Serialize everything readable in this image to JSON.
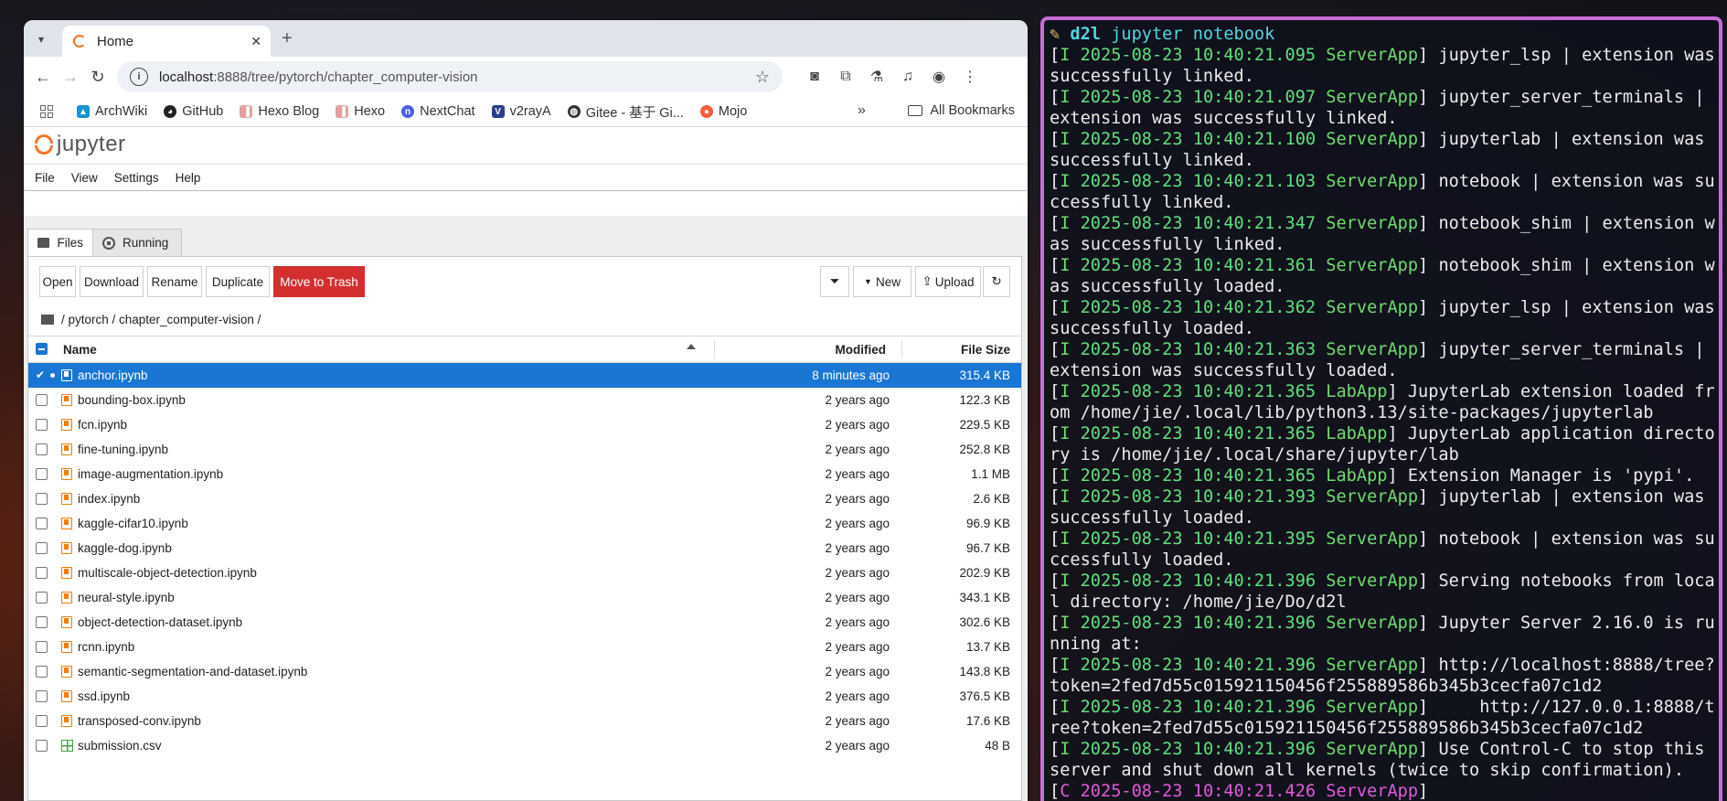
{
  "browser": {
    "tab_title": "Home",
    "url_host": "localhost",
    "url_rest": ":8888/tree/pytorch/chapter_computer-vision",
    "bookmarks": [
      "ArchWiki",
      "GitHub",
      "Hexo Blog",
      "Hexo",
      "NextChat",
      "v2rayA",
      "Gitee - 基于 Gi...",
      "Mojo"
    ],
    "all_bookmarks": "All Bookmarks"
  },
  "jupyter": {
    "logo_text": "jupyter",
    "menu": [
      "File",
      "View",
      "Settings",
      "Help"
    ],
    "tabs": [
      "Files",
      "Running"
    ],
    "actions": {
      "open": "Open",
      "download": "Download",
      "rename": "Rename",
      "duplicate": "Duplicate",
      "trash": "Move to Trash",
      "new": "New",
      "upload": "Upload"
    },
    "breadcrumb": "/ pytorch / chapter_computer-vision /",
    "columns": {
      "name": "Name",
      "modified": "Modified",
      "size": "File Size"
    },
    "files": [
      {
        "name": "anchor.ipynb",
        "modified": "8 minutes ago",
        "size": "315.4 KB",
        "type": "notebook",
        "selected": true
      },
      {
        "name": "bounding-box.ipynb",
        "modified": "2 years ago",
        "size": "122.3 KB",
        "type": "notebook"
      },
      {
        "name": "fcn.ipynb",
        "modified": "2 years ago",
        "size": "229.5 KB",
        "type": "notebook"
      },
      {
        "name": "fine-tuning.ipynb",
        "modified": "2 years ago",
        "size": "252.8 KB",
        "type": "notebook"
      },
      {
        "name": "image-augmentation.ipynb",
        "modified": "2 years ago",
        "size": "1.1 MB",
        "type": "notebook"
      },
      {
        "name": "index.ipynb",
        "modified": "2 years ago",
        "size": "2.6 KB",
        "type": "notebook"
      },
      {
        "name": "kaggle-cifar10.ipynb",
        "modified": "2 years ago",
        "size": "96.9 KB",
        "type": "notebook"
      },
      {
        "name": "kaggle-dog.ipynb",
        "modified": "2 years ago",
        "size": "96.7 KB",
        "type": "notebook"
      },
      {
        "name": "multiscale-object-detection.ipynb",
        "modified": "2 years ago",
        "size": "202.9 KB",
        "type": "notebook"
      },
      {
        "name": "neural-style.ipynb",
        "modified": "2 years ago",
        "size": "343.1 KB",
        "type": "notebook"
      },
      {
        "name": "object-detection-dataset.ipynb",
        "modified": "2 years ago",
        "size": "302.6 KB",
        "type": "notebook"
      },
      {
        "name": "rcnn.ipynb",
        "modified": "2 years ago",
        "size": "13.7 KB",
        "type": "notebook"
      },
      {
        "name": "semantic-segmentation-and-dataset.ipynb",
        "modified": "2 years ago",
        "size": "143.8 KB",
        "type": "notebook"
      },
      {
        "name": "ssd.ipynb",
        "modified": "2 years ago",
        "size": "376.5 KB",
        "type": "notebook"
      },
      {
        "name": "transposed-conv.ipynb",
        "modified": "2 years ago",
        "size": "17.6 KB",
        "type": "notebook"
      },
      {
        "name": "submission.csv",
        "modified": "2 years ago",
        "size": "48 B",
        "type": "csv"
      }
    ]
  },
  "terminal": {
    "prompt_env": "d2l",
    "prompt_cmd": "jupyter notebook",
    "lines": [
      {
        "lvl": "I",
        "ts": "2025-08-23 10:40:21.095",
        "app": "ServerApp",
        "msg": "jupyter_lsp | extension was successfully linked."
      },
      {
        "lvl": "I",
        "ts": "2025-08-23 10:40:21.097",
        "app": "ServerApp",
        "msg": "jupyter_server_terminals | extension was successfully linked."
      },
      {
        "lvl": "I",
        "ts": "2025-08-23 10:40:21.100",
        "app": "ServerApp",
        "msg": "jupyterlab | extension was successfully linked."
      },
      {
        "lvl": "I",
        "ts": "2025-08-23 10:40:21.103",
        "app": "ServerApp",
        "msg": "notebook | extension was successfully linked."
      },
      {
        "lvl": "I",
        "ts": "2025-08-23 10:40:21.347",
        "app": "ServerApp",
        "msg": "notebook_shim | extension was successfully linked."
      },
      {
        "lvl": "I",
        "ts": "2025-08-23 10:40:21.361",
        "app": "ServerApp",
        "msg": "notebook_shim | extension was successfully loaded."
      },
      {
        "lvl": "I",
        "ts": "2025-08-23 10:40:21.362",
        "app": "ServerApp",
        "msg": "jupyter_lsp | extension was successfully loaded."
      },
      {
        "lvl": "I",
        "ts": "2025-08-23 10:40:21.363",
        "app": "ServerApp",
        "msg": "jupyter_server_terminals | extension was successfully loaded."
      },
      {
        "lvl": "I",
        "ts": "2025-08-23 10:40:21.365",
        "app": "LabApp",
        "msg": "JupyterLab extension loaded from /home/jie/.local/lib/python3.13/site-packages/jupyterlab"
      },
      {
        "lvl": "I",
        "ts": "2025-08-23 10:40:21.365",
        "app": "LabApp",
        "msg": "JupyterLab application directory is /home/jie/.local/share/jupyter/lab"
      },
      {
        "lvl": "I",
        "ts": "2025-08-23 10:40:21.365",
        "app": "LabApp",
        "msg": "Extension Manager is 'pypi'."
      },
      {
        "lvl": "I",
        "ts": "2025-08-23 10:40:21.393",
        "app": "ServerApp",
        "msg": "jupyterlab | extension was successfully loaded."
      },
      {
        "lvl": "I",
        "ts": "2025-08-23 10:40:21.395",
        "app": "ServerApp",
        "msg": "notebook | extension was successfully loaded."
      },
      {
        "lvl": "I",
        "ts": "2025-08-23 10:40:21.396",
        "app": "ServerApp",
        "msg": "Serving notebooks from local directory: /home/jie/Do/d2l"
      },
      {
        "lvl": "I",
        "ts": "2025-08-23 10:40:21.396",
        "app": "ServerApp",
        "msg": "Jupyter Server 2.16.0 is running at:"
      },
      {
        "lvl": "I",
        "ts": "2025-08-23 10:40:21.396",
        "app": "ServerApp",
        "msg": "http://localhost:8888/tree?token=2fed7d55c015921150456f255889586b345b3cecfa07c1d2"
      },
      {
        "lvl": "I",
        "ts": "2025-08-23 10:40:21.396",
        "app": "ServerApp",
        "msg": "    http://127.0.0.1:8888/tree?token=2fed7d55c015921150456f255889586b345b3cecfa07c1d2"
      },
      {
        "lvl": "I",
        "ts": "2025-08-23 10:40:21.396",
        "app": "ServerApp",
        "msg": "Use Control-C to stop this server and shut down all kernels (twice to skip confirmation)."
      },
      {
        "lvl": "C",
        "ts": "2025-08-23 10:40:21.426",
        "app": "ServerApp",
        "msg": ""
      }
    ]
  },
  "colors": {
    "accent": "#1976d2",
    "trash": "#d32f2f",
    "jupyter_orange": "#f37726",
    "terminal_border": "#c86dd7"
  }
}
